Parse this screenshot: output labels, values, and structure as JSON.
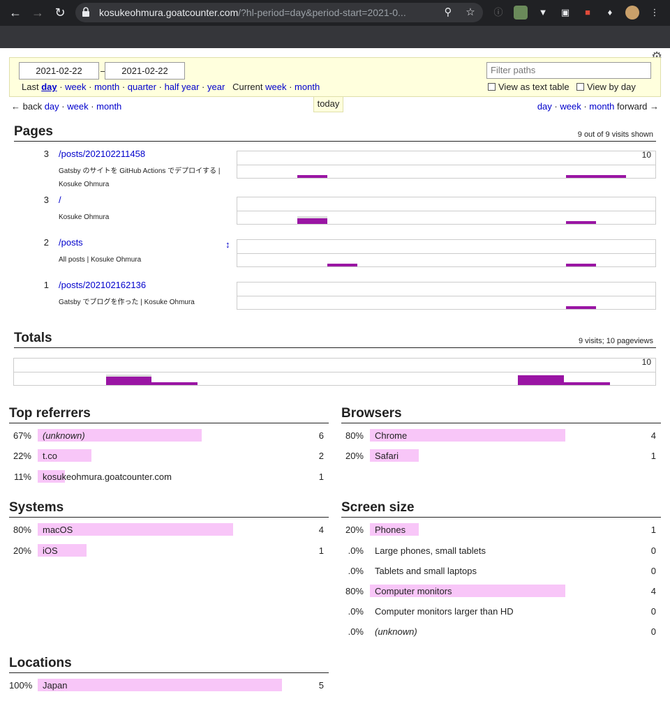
{
  "browser": {
    "url_main": "kosukeohmura.goatcounter.com",
    "url_rest": "/?hl-period=day&period-start=2021-0..."
  },
  "period": {
    "start": "2021-02-22",
    "dash": "–",
    "end": "2021-02-22",
    "last": "Last",
    "last_links": [
      "day",
      "week",
      "month",
      "quarter",
      "half year",
      "year"
    ],
    "current": "Current",
    "current_links": [
      "week",
      "month"
    ],
    "filter_placeholder": "Filter paths",
    "view_text_table": "View as text table",
    "view_by_day": "View by day"
  },
  "nav": {
    "back": "← back",
    "back_links": [
      "day",
      "week",
      "month"
    ],
    "today": "today",
    "fwd_links": [
      "day",
      "week",
      "month"
    ],
    "forward": "forward →"
  },
  "pages": {
    "title": "Pages",
    "meta": "9 out of 9 visits shown",
    "chart_max": "10",
    "rows": [
      {
        "count": "3",
        "path": "/posts/202102211458",
        "title": "Gatsby のサイトを GitHub Actions でデプロイする | Kosuke Ohmura"
      },
      {
        "count": "3",
        "path": "/",
        "title": "Kosuke Ohmura"
      },
      {
        "count": "2",
        "path": "/posts",
        "title": "All posts | Kosuke Ohmura"
      },
      {
        "count": "1",
        "path": "/posts/202102162136",
        "title": "Gatsby でブログを作った | Kosuke Ohmura"
      }
    ],
    "resize_icon": "↕"
  },
  "totals": {
    "title": "Totals",
    "meta": "9 visits; 10 pageviews",
    "chart_max": "10"
  },
  "referrers": {
    "title": "Top referrers",
    "rows": [
      {
        "pct": "67%",
        "label": "(unknown)",
        "count": "6",
        "fraction": 0.67,
        "italic": true
      },
      {
        "pct": "22%",
        "label": "t.co",
        "count": "2",
        "fraction": 0.22
      },
      {
        "pct": "11%",
        "label": "kosukeohmura.goatcounter.com",
        "count": "1",
        "fraction": 0.11
      }
    ]
  },
  "browsers": {
    "title": "Browsers",
    "rows": [
      {
        "pct": "80%",
        "label": "Chrome",
        "count": "4",
        "fraction": 0.8
      },
      {
        "pct": "20%",
        "label": "Safari",
        "count": "1",
        "fraction": 0.2
      }
    ]
  },
  "systems": {
    "title": "Systems",
    "rows": [
      {
        "pct": "80%",
        "label": "macOS",
        "count": "4",
        "fraction": 0.8
      },
      {
        "pct": "20%",
        "label": "iOS",
        "count": "1",
        "fraction": 0.2
      }
    ]
  },
  "screen": {
    "title": "Screen size",
    "rows": [
      {
        "pct": "20%",
        "label": "Phones",
        "count": "1",
        "fraction": 0.2
      },
      {
        "pct": ".0%",
        "label": "Large phones, small tablets",
        "count": "0",
        "fraction": 0
      },
      {
        "pct": ".0%",
        "label": "Tablets and small laptops",
        "count": "0",
        "fraction": 0
      },
      {
        "pct": "80%",
        "label": "Computer monitors",
        "count": "4",
        "fraction": 0.8
      },
      {
        "pct": ".0%",
        "label": "Computer monitors larger than HD",
        "count": "0",
        "fraction": 0
      },
      {
        "pct": ".0%",
        "label": "(unknown)",
        "count": "0",
        "fraction": 0,
        "italic": true
      }
    ]
  },
  "locations": {
    "title": "Locations",
    "rows": [
      {
        "pct": "100%",
        "label": "Japan",
        "count": "5",
        "fraction": 1.0
      }
    ]
  },
  "colors": {
    "bar": "#9a15a4",
    "hbar": "#f8c6f8",
    "link": "#0000cc",
    "period_bg": "#ffffdd"
  }
}
